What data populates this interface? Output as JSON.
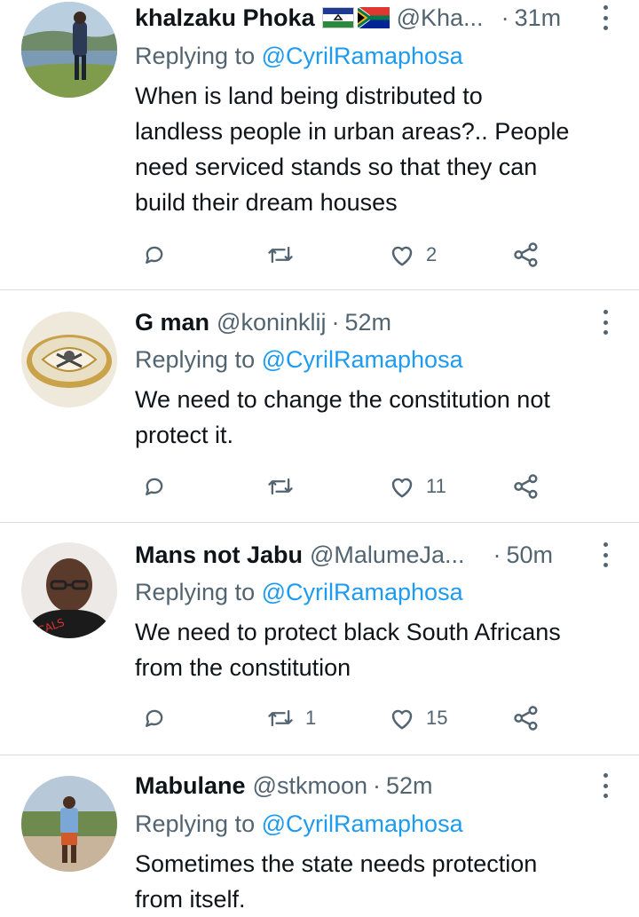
{
  "colors": {
    "text": "#0f1419",
    "muted": "#536471",
    "accent": "#1d9bf0",
    "divider": "#d9dde1"
  },
  "tweets": [
    {
      "name": "khalzaku Phoka",
      "handle": "@Kha...",
      "separator": "·",
      "time": "31m",
      "flags": [
        "lesotho-flag-icon",
        "south-africa-flag-icon"
      ],
      "reply_prefix": "Replying to",
      "reply_to": "@CyrilRamaphosa",
      "text_lines": [
        "When is land being distributed to",
        "landless people in urban areas?.. People",
        "need serviced stands so that they can",
        "build their dream houses"
      ],
      "replies": "",
      "retweets": "",
      "likes": "2"
    },
    {
      "name": "G man",
      "handle": "@koninklij",
      "separator": "·",
      "time": "52m",
      "flags": [],
      "reply_prefix": "Replying to",
      "reply_to": "@CyrilRamaphosa",
      "text_lines": [
        "We need to change the constitution not",
        "protect it."
      ],
      "replies": "",
      "retweets": "",
      "likes": "11"
    },
    {
      "name": "Mans not Jabu",
      "handle": "@MalumeJa...",
      "separator": "·",
      "time": "50m",
      "flags": [],
      "reply_prefix": "Replying to",
      "reply_to": "@CyrilRamaphosa",
      "text_lines": [
        "We need to protect black South Africans",
        "from the constitution"
      ],
      "replies": "",
      "retweets": "1",
      "likes": "15"
    },
    {
      "name": "Mabulane",
      "handle": "@stkmoon",
      "separator": "·",
      "time": "52m",
      "flags": [],
      "reply_prefix": "Replying to",
      "reply_to": "@CyrilRamaphosa",
      "text_lines": [
        "Sometimes the state needs protection",
        "from itself."
      ],
      "replies": "",
      "retweets": "",
      "likes": ""
    }
  ]
}
